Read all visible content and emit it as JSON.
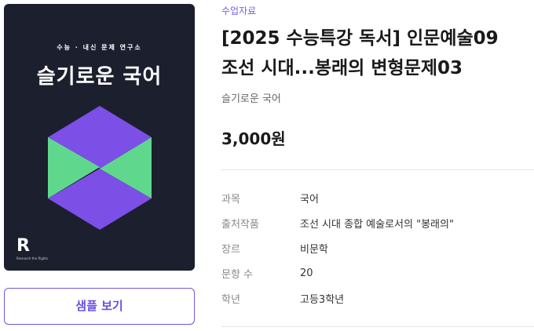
{
  "cover": {
    "tagline": "수능 · 내신 문제 연구소",
    "title": "슬기로운 국어",
    "publisher_mark": "R",
    "publisher_text": "Research the Rights"
  },
  "sample_button": "샘플 보기",
  "category": "수업자료",
  "title_line1": "[2025 수능특강 독서] 인문예술09",
  "title_line2": "조선 시대...봉래의 변형문제03",
  "author": "슬기로운 국어",
  "price": "3,000원",
  "info": [
    {
      "label": "과목",
      "value": "국어"
    },
    {
      "label": "출처작품",
      "value": "조선 시대 종합 예술로서의 \"봉래의\""
    },
    {
      "label": "장르",
      "value": "비문학"
    },
    {
      "label": "문항 수",
      "value": "20"
    },
    {
      "label": "학년",
      "value": "고등3학년"
    }
  ],
  "colors": {
    "accent": "#6a4fe0",
    "cover_bg": "#1c1f2e",
    "logo_purple": "#7c4fe6",
    "logo_green": "#5fd88e"
  }
}
